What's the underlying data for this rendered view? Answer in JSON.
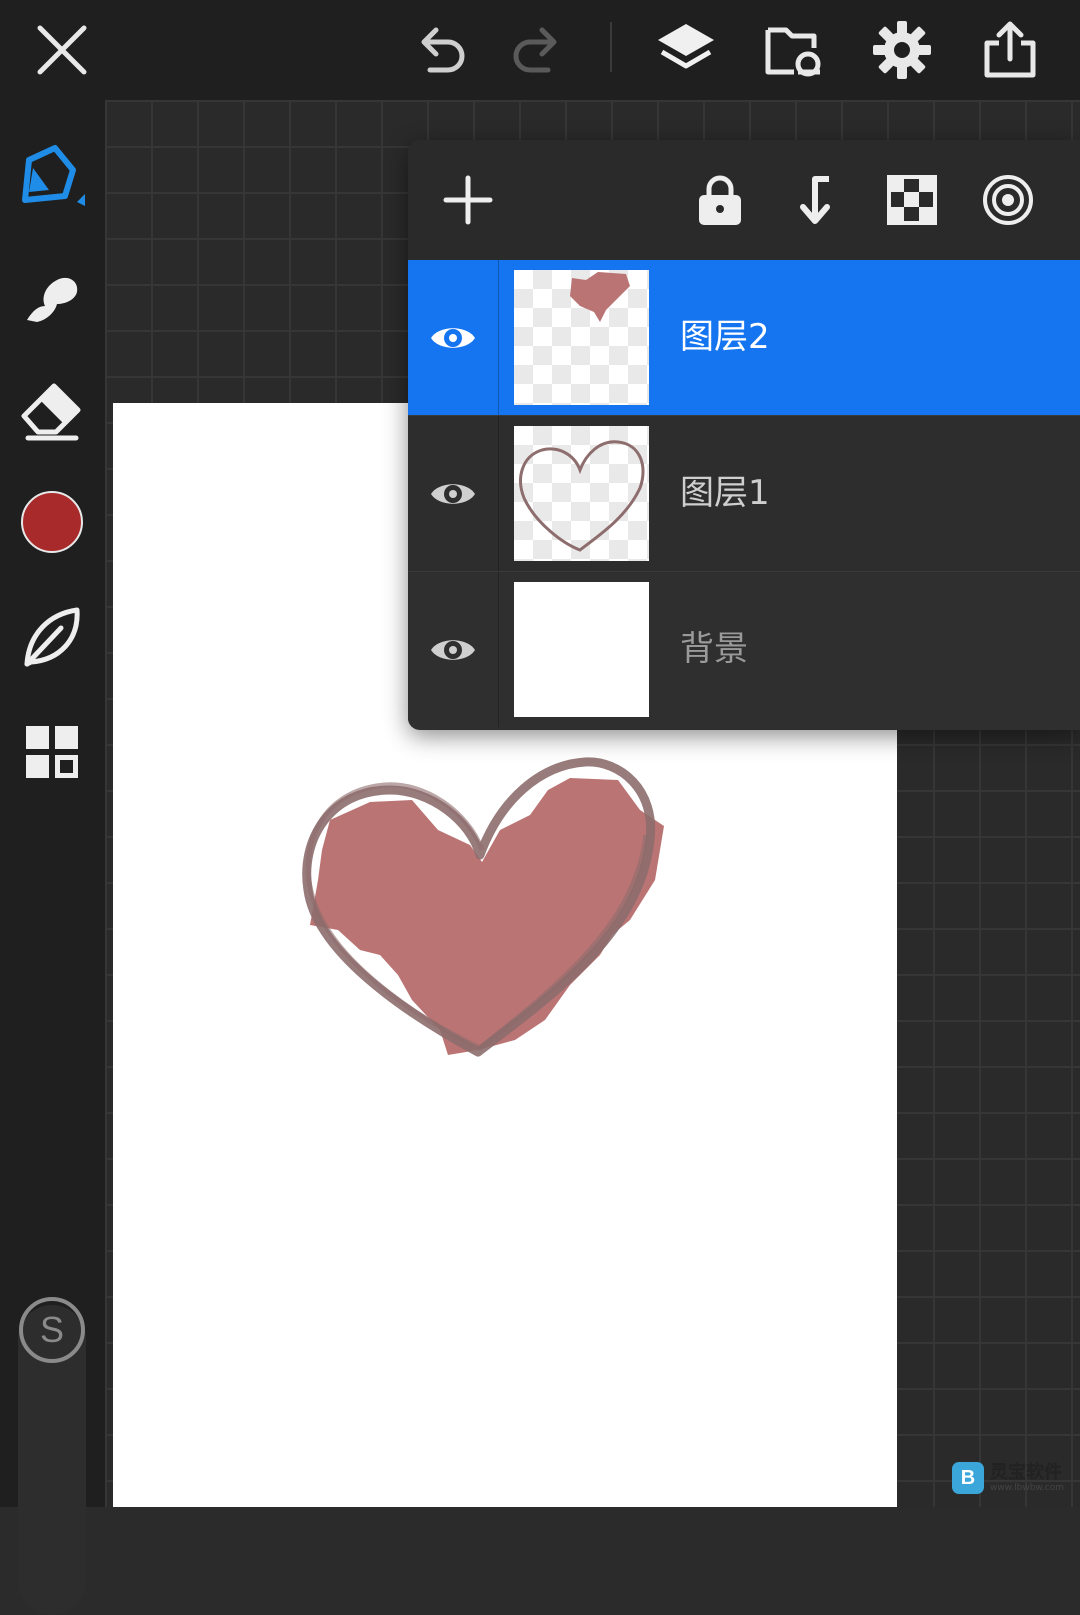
{
  "top_bar": {
    "icons": [
      "close-icon",
      "undo-icon",
      "redo-icon",
      "layers-icon",
      "gallery-icon",
      "settings-icon",
      "share-icon"
    ]
  },
  "left_toolbar": {
    "tools": [
      "brush-icon",
      "smudge-icon",
      "eraser-icon",
      "color-swatch",
      "leaf-shape-icon",
      "gallery-grid-icon"
    ],
    "current_color": "#a82a2a",
    "stabilizer_label": "S"
  },
  "layers_panel": {
    "toolbar_icons": [
      "add-icon",
      "lock-icon",
      "merge-down-icon",
      "checkerboard-icon",
      "target-icon"
    ],
    "layers": [
      {
        "name": "图层2",
        "visible": true,
        "selected": true
      },
      {
        "name": "图层1",
        "visible": true,
        "selected": false
      },
      {
        "name": "背景",
        "visible": true,
        "selected": false
      }
    ]
  },
  "canvas": {
    "background": "#ffffff",
    "outline_color": "#8b6b6b",
    "fill_color": "#bb7474"
  },
  "watermark": {
    "logo_letter": "B",
    "name": "灵宝软件",
    "url": "www.lbwbw.com"
  }
}
